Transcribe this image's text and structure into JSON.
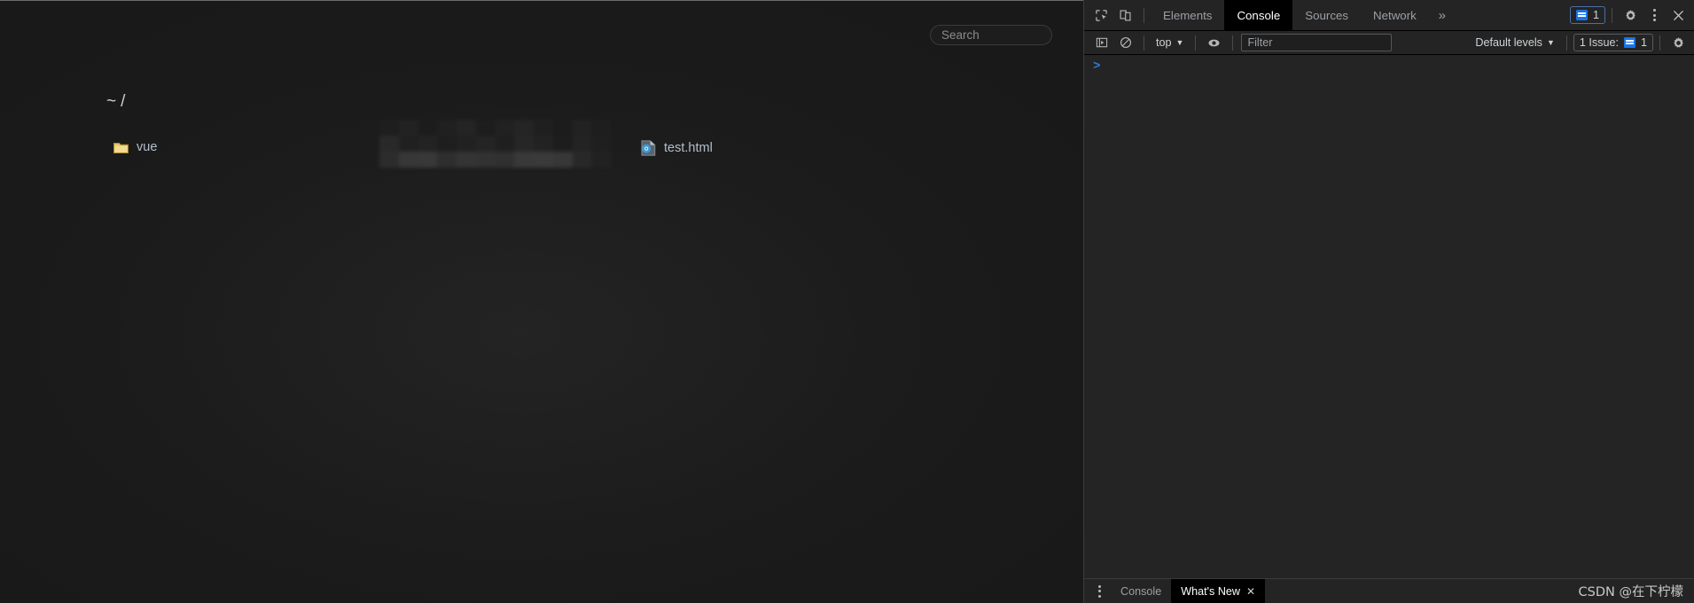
{
  "page": {
    "search": {
      "placeholder": "Search",
      "value": ""
    },
    "breadcrumb": {
      "home": "~",
      "separator": "/"
    },
    "entries": [
      {
        "name": "vue",
        "type": "folder",
        "icon": "folder-icon",
        "column": 0
      },
      {
        "name": "test.html",
        "type": "file",
        "icon": "html-file-icon",
        "column": 2
      }
    ],
    "censored_block": {
      "label": "redacted-filename",
      "visible": true
    }
  },
  "devtools": {
    "toolbar": {
      "inspect_icon": "inspect-element-icon",
      "device_icon": "device-toolbar-icon",
      "tabs": [
        {
          "label": "Elements",
          "active": false
        },
        {
          "label": "Console",
          "active": true
        },
        {
          "label": "Sources",
          "active": false
        },
        {
          "label": "Network",
          "active": false
        }
      ],
      "more_tabs": "»",
      "issues_badge": {
        "count": "1",
        "icon": "issue-message-icon"
      },
      "settings_icon": "gear-icon",
      "more_options_icon": "vertical-dots-icon",
      "close_icon": "close-icon"
    },
    "console_bar": {
      "sidebar_toggle_icon": "console-sidebar-icon",
      "clear_icon": "clear-console-icon",
      "context": "top",
      "eye_icon": "live-expression-icon",
      "filter_placeholder": "Filter",
      "filter_value": "",
      "levels": "Default levels",
      "issues_text": "1 Issue:",
      "issues_count": "1",
      "settings_icon": "gear-icon"
    },
    "console": {
      "prompt": ">",
      "input_value": ""
    },
    "drawer": {
      "menu_icon": "vertical-dots-icon",
      "tabs": [
        {
          "label": "Console",
          "active": false,
          "closable": false
        },
        {
          "label": "What's New",
          "active": true,
          "closable": true
        }
      ],
      "close_glyph": "✕"
    },
    "watermark": "CSDN @在下柠檬"
  },
  "colors": {
    "page_bg": "#191919",
    "devtools_bg": "#242424",
    "accent_blue": "#1a73e8",
    "prompt_blue": "#2b7cd3",
    "text_muted": "#9aa0a6",
    "link_text": "#b3bfca",
    "folder_yellow": "#e8c860"
  }
}
